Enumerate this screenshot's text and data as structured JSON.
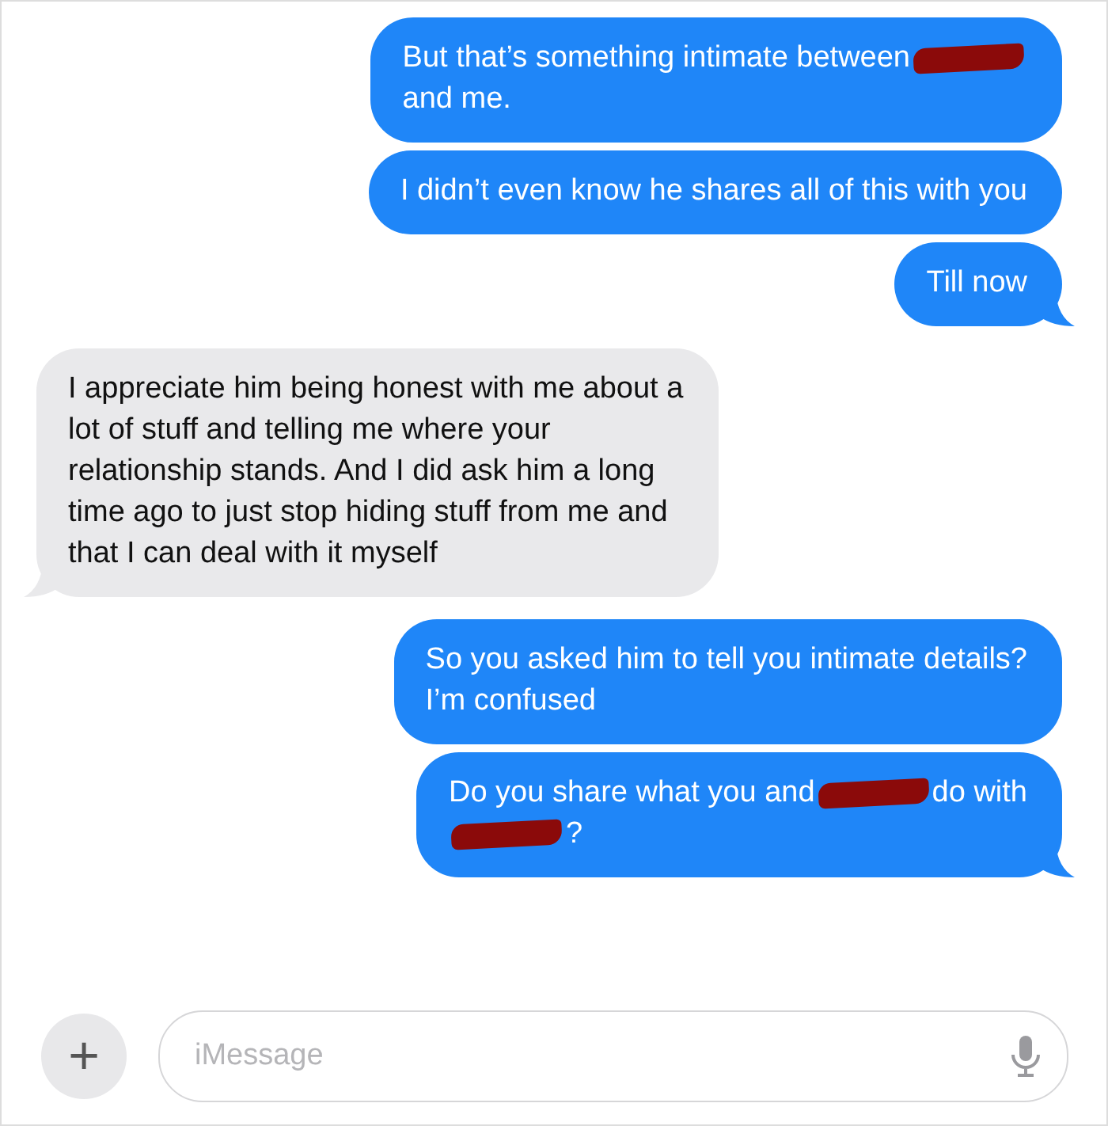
{
  "messages": [
    {
      "kind": "sent",
      "tail": false,
      "lines": [
        [
          {
            "kind": "text",
            "text": "But that’s something intimate between"
          },
          {
            "kind": "redaction"
          }
        ],
        [
          {
            "kind": "text",
            "text": "and me."
          }
        ]
      ]
    },
    {
      "kind": "sent",
      "tail": false,
      "lines": [
        [
          {
            "kind": "text",
            "text": "I didn’t even know he shares all of this with you"
          }
        ]
      ]
    },
    {
      "kind": "sent",
      "tail": true,
      "lines": [
        [
          {
            "kind": "text",
            "text": "Till now"
          }
        ]
      ]
    },
    {
      "kind": "received",
      "tail": true,
      "lines": [
        [
          {
            "kind": "text",
            "text": "I appreciate him being honest with me about a"
          }
        ],
        [
          {
            "kind": "text",
            "text": "lot of stuff and telling me where your"
          }
        ],
        [
          {
            "kind": "text",
            "text": "relationship stands. And I did ask him a long"
          }
        ],
        [
          {
            "kind": "text",
            "text": "time ago to just stop hiding stuff from me and"
          }
        ],
        [
          {
            "kind": "text",
            "text": "that I can deal with it myself"
          }
        ]
      ]
    },
    {
      "kind": "sent",
      "tail": false,
      "lines": [
        [
          {
            "kind": "text",
            "text": "So you asked him to tell you intimate details?"
          }
        ],
        [
          {
            "kind": "text",
            "text": "I’m confused"
          }
        ]
      ]
    },
    {
      "kind": "sent",
      "tail": true,
      "lines": [
        [
          {
            "kind": "text",
            "text": "Do you share what you and"
          },
          {
            "kind": "redaction"
          },
          {
            "kind": "text",
            "text": "do with"
          }
        ],
        [
          {
            "kind": "redaction"
          },
          {
            "kind": "text",
            "text": "?"
          }
        ]
      ]
    }
  ],
  "composer": {
    "add_button": "+",
    "placeholder": "iMessage"
  }
}
